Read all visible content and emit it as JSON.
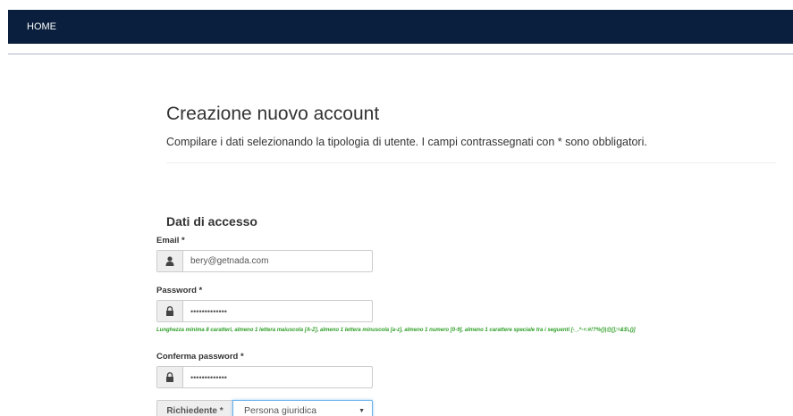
{
  "nav": {
    "home_label": "HOME"
  },
  "header": {
    "title": "Creazione nuovo account",
    "subtitle": "Compilare i dati selezionando la tipologia di utente. I campi contrassegnati con * sono obbligatori."
  },
  "access_section": {
    "title": "Dati di accesso",
    "email": {
      "label": "Email *",
      "value": "bery@getnada.com",
      "icon": "user-icon"
    },
    "password": {
      "label": "Password *",
      "value": "•••••••••••••",
      "icon": "lock-icon"
    },
    "password_hint": "Lunghezza minima 8 caratteri, almeno 1 lettera maiuscola [A-Z], almeno 1 lettera minuscola [a-z], almeno 1 numero [0-9], almeno 1 carattere speciale tra i seguenti [-_.*-+:#!?%{}|@[];=&$\\,()]",
    "confirm_password": {
      "label": "Conferma password *",
      "value": "•••••••••••••",
      "icon": "lock-icon"
    },
    "requester": {
      "label": "Richiedente *",
      "selected": "Persona giuridica"
    }
  },
  "colors": {
    "navbar": "#0a1f3d",
    "hint": "#2e9e27",
    "focus": "#66afe9"
  }
}
